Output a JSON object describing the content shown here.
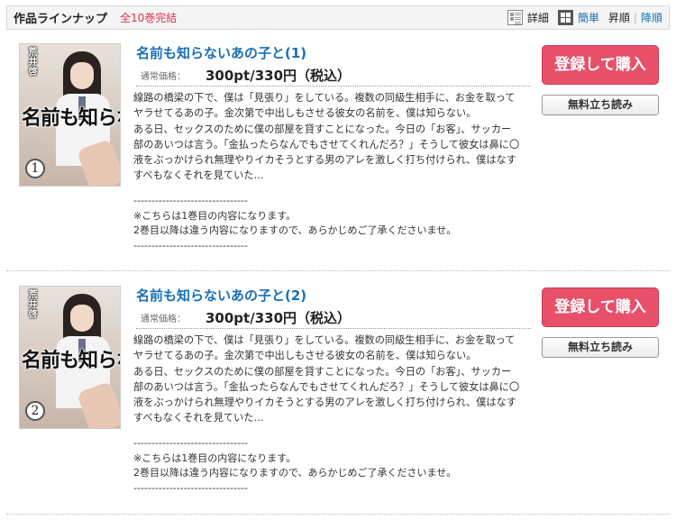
{
  "header": {
    "title": "作品ラインナップ",
    "count": "全10巻完結",
    "view_detail": "詳細",
    "view_simple": "簡単",
    "sort_asc": "昇順",
    "sort_sep": "|",
    "sort_desc": "降順"
  },
  "items": [
    {
      "title": "名前も知らないあの子と(1)",
      "price_label": "通常価格：",
      "price": "300pt/330円（税込）",
      "description": "線路の橋梁の下で、僕は「見張り」をしている。複数の同級生相手に、お金を取って\nヤラせてるあの子。金次第で中出しもさせる彼女の名前を、僕は知らない。\nある日、セックスのために僕の部屋を貸すことになった。今日の「お客」、サッカー\n部のあいつは言う。「金払ったらなんでもさせてくれんだろ？」そうして彼女は鼻に〇\n液をぶっかけられ無理やりイカそうとする男のアレを激しく打ち付けられ、僕はなす\nすべもなくそれを見ていた…",
      "note": "--------------------------------\n※こちらは1巻目の内容になります。\n2巻目以降は違う内容になりますので、あらかじめご了承くださいませ。\n--------------------------------",
      "buy_label": "登録して購入",
      "trial_label": "無料立ち読み",
      "cover_author": "荒井啓",
      "cover_title": "名前も知らないあの子と",
      "cover_volume": "1"
    },
    {
      "title": "名前も知らないあの子と(2)",
      "price_label": "通常価格：",
      "price": "300pt/330円（税込）",
      "description": "線路の橋梁の下で、僕は「見張り」をしている。複数の同級生相手に、お金を取って\nヤラせてるあの子。金次第で中出しもさせる彼女の名前を、僕は知らない。\nある日、セックスのために僕の部屋を貸すことになった。今日の「お客」、サッカー\n部のあいつは言う。「金払ったらなんでもさせてくれんだろ？」そうして彼女は鼻に〇\n液をぶっかけられ無理やりイカそうとする男のアレを激しく打ち付けられ、僕はなす\nすべもなくそれを見ていた…",
      "note": "--------------------------------\n※こちらは1巻目の内容になります。\n2巻目以降は違う内容になりますので、あらかじめご了承くださいませ。\n--------------------------------",
      "buy_label": "登録して購入",
      "trial_label": "無料立ち読み",
      "cover_author": "荒井啓",
      "cover_title": "名前も知らないあの子と",
      "cover_volume": "2"
    }
  ],
  "colors": {
    "accent_link": "#1a6fb5",
    "buy_button": "#e8506a",
    "count_text": "#e0334c"
  }
}
